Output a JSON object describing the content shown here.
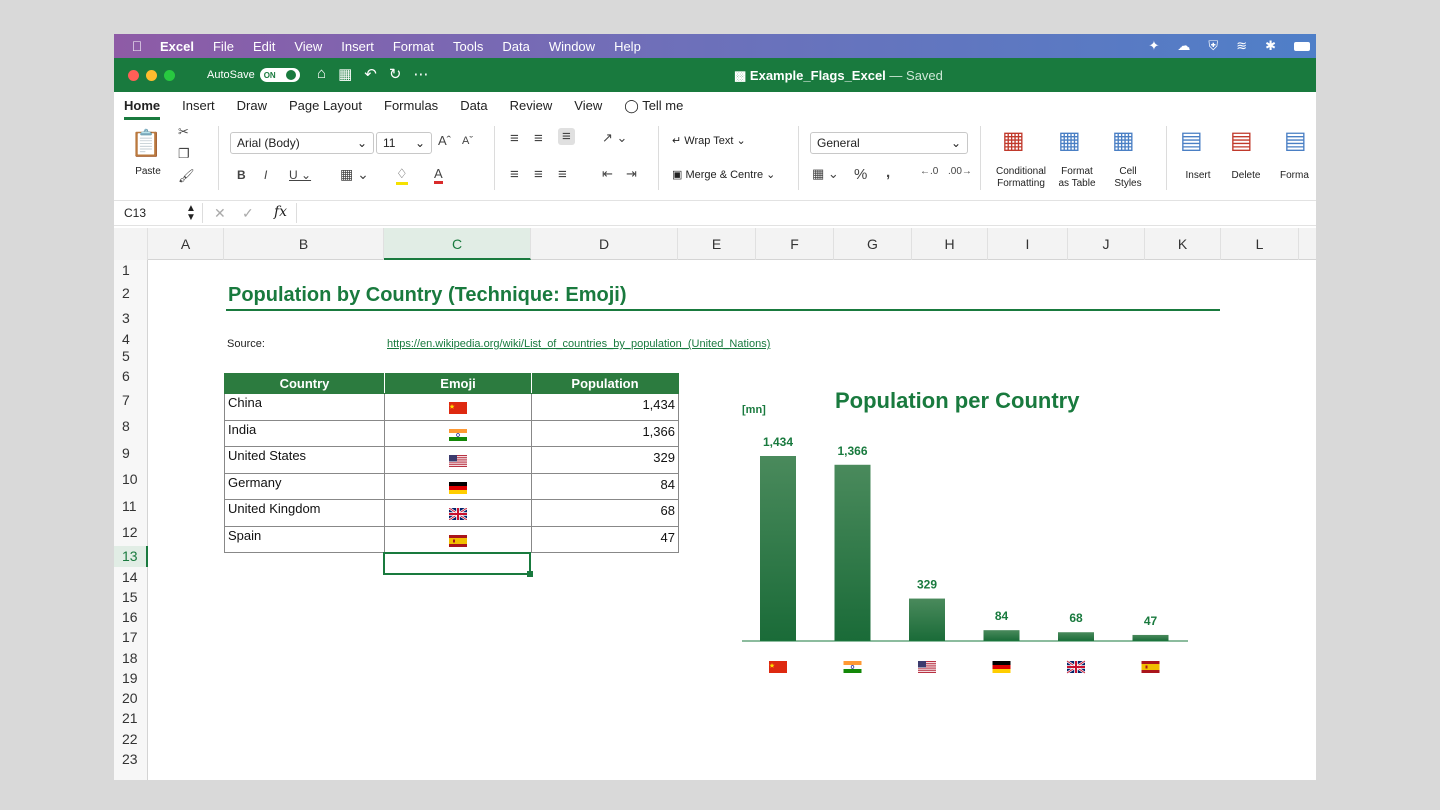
{
  "menubar": {
    "app": "Excel",
    "items": [
      "File",
      "Edit",
      "View",
      "Insert",
      "Format",
      "Tools",
      "Data",
      "Window",
      "Help"
    ]
  },
  "titlebar": {
    "autosave_label": "AutoSave",
    "autosave_state": "ON",
    "doc_name": "Example_Flags_Excel",
    "saved_status": "— Saved"
  },
  "ribbon_tabs": [
    "Home",
    "Insert",
    "Draw",
    "Page Layout",
    "Formulas",
    "Data",
    "Review",
    "View",
    "Tell me"
  ],
  "ribbon": {
    "paste": "Paste",
    "font_name": "Arial (Body)",
    "font_size": "11",
    "wrap_text": "Wrap Text",
    "merge_centre": "Merge & Centre",
    "number_format": "General",
    "conditional": [
      "Conditional",
      "Formatting"
    ],
    "format_table": [
      "Format",
      "as Table"
    ],
    "cell_styles": [
      "Cell",
      "Styles"
    ],
    "insert": "Insert",
    "delete": "Delete",
    "format": "Forma"
  },
  "formula_bar": {
    "name_box": "C13",
    "fx": "fx",
    "value": ""
  },
  "columns": [
    "A",
    "B",
    "C",
    "D",
    "E",
    "F",
    "G",
    "H",
    "I",
    "J",
    "K",
    "L"
  ],
  "rows": [
    "1",
    "2",
    "3",
    "4",
    "5",
    "6",
    "7",
    "8",
    "9",
    "10",
    "11",
    "12",
    "13",
    "14",
    "15",
    "16",
    "17",
    "18",
    "19",
    "20",
    "21",
    "22",
    "23"
  ],
  "sheet": {
    "title": "Population by Country (Technique: Emoji)",
    "source_label": "Source:",
    "source_url": "https://en.wikipedia.org/wiki/List_of_countries_by_population_(United_Nations)",
    "table_headers": [
      "Country",
      "Emoji",
      "Population"
    ],
    "table_rows": [
      {
        "country": "China",
        "flag": "cn",
        "population": "1,434"
      },
      {
        "country": "India",
        "flag": "in",
        "population": "1,366"
      },
      {
        "country": "United States",
        "flag": "us",
        "population": "329"
      },
      {
        "country": "Germany",
        "flag": "de",
        "population": "84"
      },
      {
        "country": "United Kingdom",
        "flag": "gb",
        "population": "68"
      },
      {
        "country": "Spain",
        "flag": "es",
        "population": "47"
      }
    ]
  },
  "colors": {
    "excel_green": "#197a3e",
    "bar_top": "#4a8a5c",
    "bar_bottom": "#1a6b38"
  },
  "chart_data": {
    "type": "bar",
    "title": "Population per Country",
    "ylabel": "[mn]",
    "categories": [
      "cn",
      "in",
      "us",
      "de",
      "gb",
      "es"
    ],
    "values": [
      1434,
      1366,
      329,
      84,
      68,
      47
    ],
    "value_labels": [
      "1,434",
      "1,366",
      "329",
      "84",
      "68",
      "47"
    ],
    "ylim": [
      0,
      1434
    ],
    "grid": false,
    "legend": "none"
  }
}
